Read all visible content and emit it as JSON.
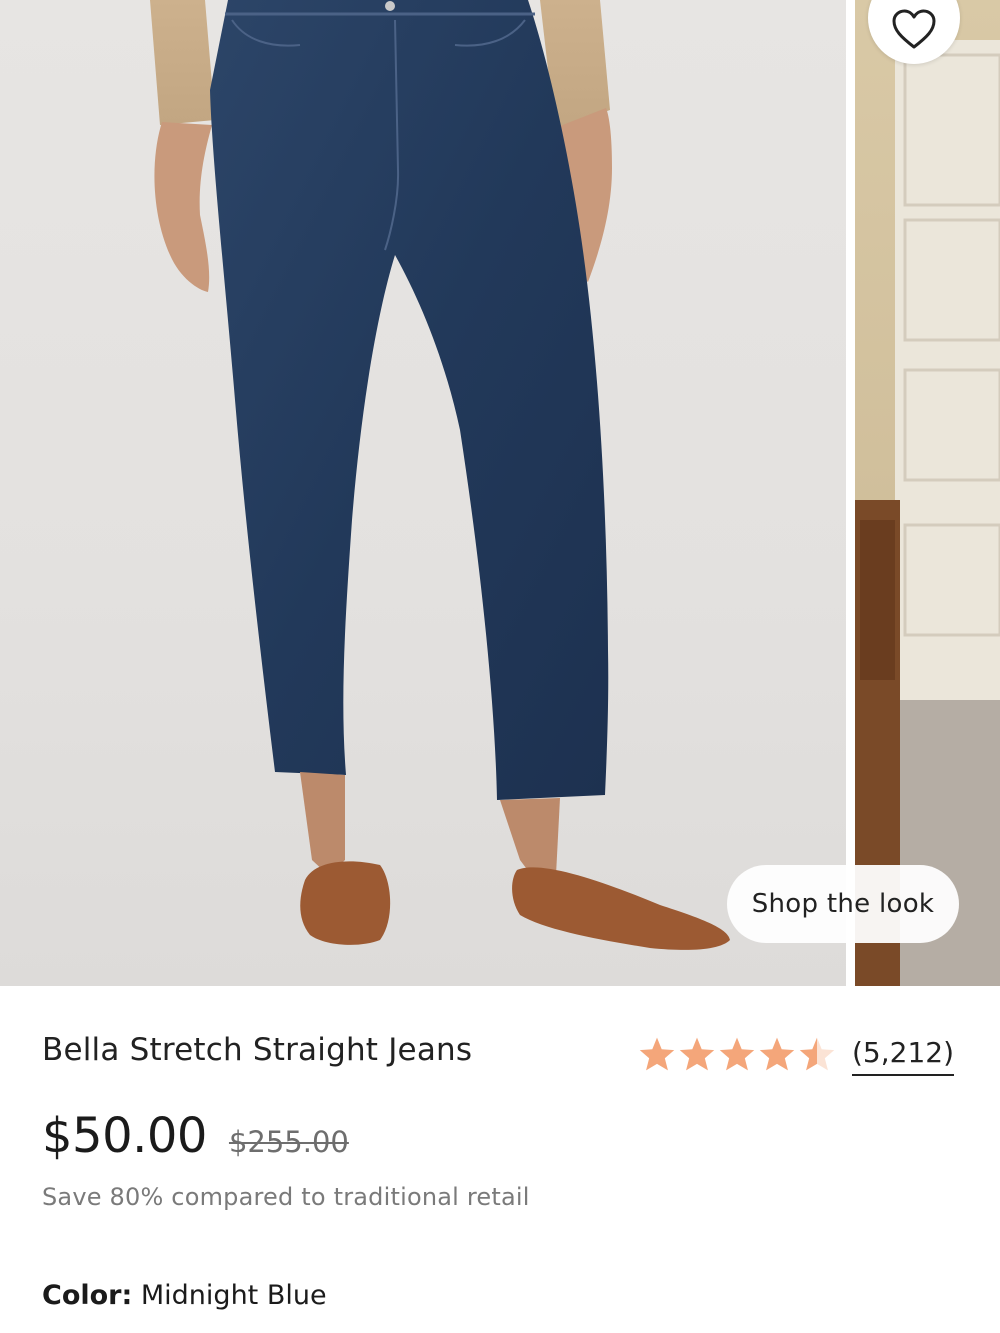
{
  "gallery": {
    "favorite_icon": "heart-outline-icon",
    "shop_the_look_label": "Shop the look"
  },
  "product": {
    "title": "Bella Stretch Straight Jeans",
    "rating": {
      "value": 4.5,
      "max": 5,
      "review_count": "(5,212)",
      "star_color": "#F4A67A"
    },
    "price": {
      "current": "$50.00",
      "original": "$255.00"
    },
    "savings_note": "Save 80% compared to traditional retail",
    "color": {
      "label": "Color:",
      "value": "Midnight Blue"
    }
  }
}
